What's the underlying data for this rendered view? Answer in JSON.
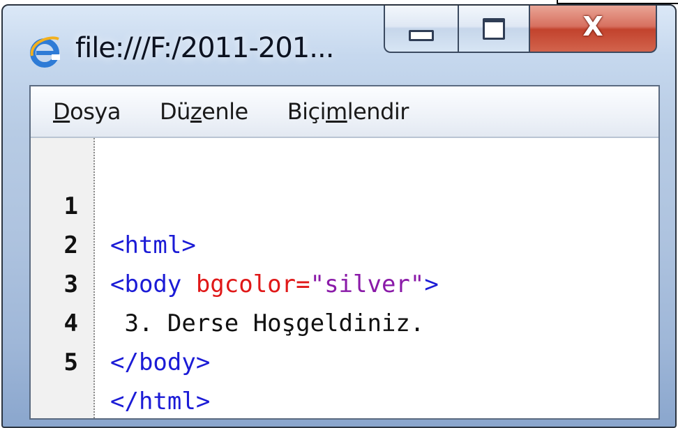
{
  "window": {
    "title": "file:///F:/2011-201...",
    "icon": "internet-explorer-icon",
    "controls": {
      "minimize_icon": "minimize-icon",
      "maximize_icon": "maximize-icon",
      "close_label": "X"
    }
  },
  "menu": {
    "items": [
      {
        "pre": "",
        "mnemonic": "D",
        "post": "osya"
      },
      {
        "pre": "Dü",
        "mnemonic": "z",
        "post": "enle"
      },
      {
        "pre": "Biçi",
        "mnemonic": "m",
        "post": "lendir"
      }
    ]
  },
  "editor": {
    "lines": [
      {
        "num": "1",
        "t1": "<html>",
        "a1": "",
        "v1": "",
        "t2": "",
        "x": ""
      },
      {
        "num": "2",
        "t1": "<body ",
        "a1": "bgcolor=",
        "v1": "\"silver\"",
        "t2": ">",
        "x": ""
      },
      {
        "num": "3",
        "t1": "",
        "a1": "",
        "v1": "",
        "t2": "",
        "x": " 3. Derse Hoşgeldiniz."
      },
      {
        "num": "4",
        "t1": "</body>",
        "a1": "",
        "v1": "",
        "t2": "",
        "x": ""
      },
      {
        "num": "5",
        "t1": "</html>",
        "a1": "",
        "v1": "",
        "t2": "",
        "x": ""
      }
    ]
  },
  "colors": {
    "tag": "#1b1bd6",
    "attribute": "#e01818",
    "value": "#8a1aa8",
    "text": "#111111",
    "close_button": "#c2432d"
  }
}
